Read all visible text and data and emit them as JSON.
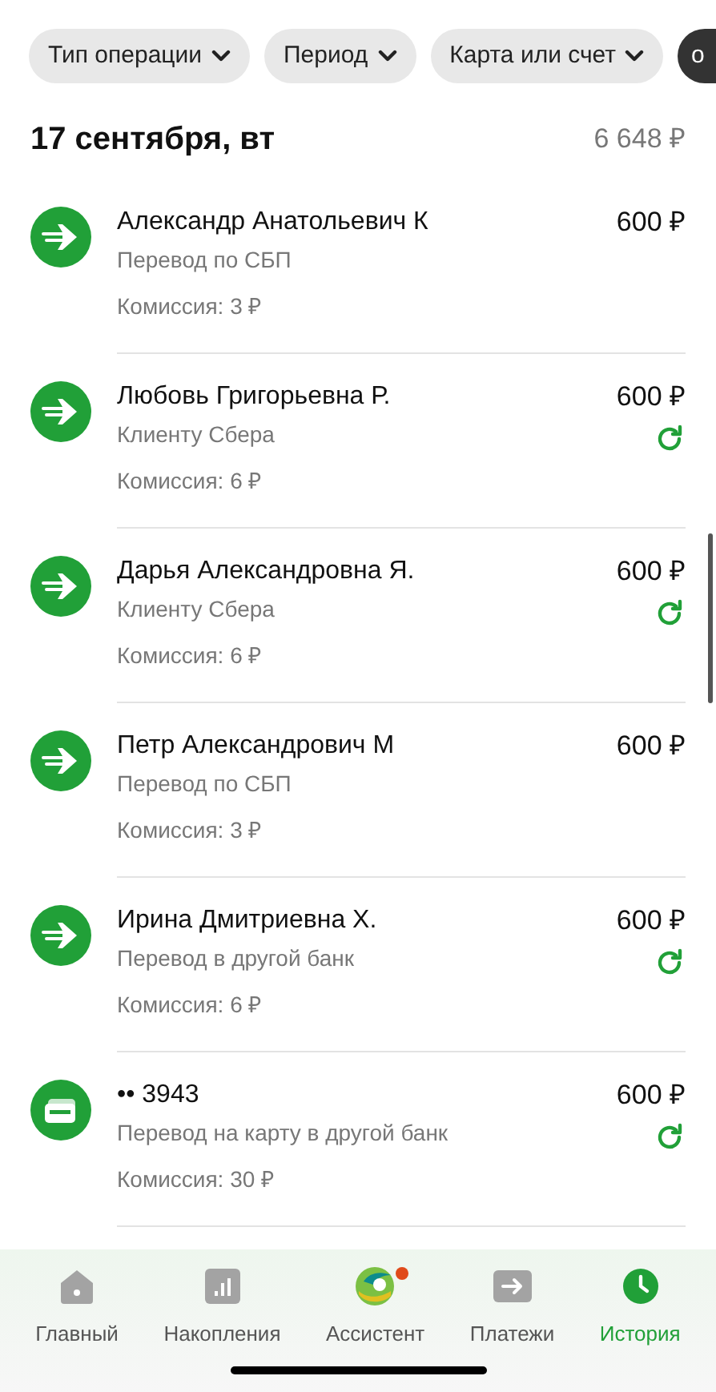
{
  "filters": [
    {
      "label": "Тип операции",
      "kind": "dropdown"
    },
    {
      "label": "Период",
      "kind": "dropdown"
    },
    {
      "label": "Карта или счет",
      "kind": "dropdown"
    },
    {
      "label": "о",
      "kind": "dark"
    }
  ],
  "day": {
    "date": "17 сентября, вт",
    "total": "6 648 ₽"
  },
  "transactions": [
    {
      "kind": "transfer",
      "name": "Александр Анатольевич К",
      "type": "Перевод по СБП",
      "commission": "Комиссия: 3 ₽",
      "amount": "600 ₽",
      "repeat": false
    },
    {
      "kind": "transfer",
      "name": "Любовь Григорьевна Р.",
      "type": "Клиенту Сбера",
      "commission": "Комиссия: 6 ₽",
      "amount": "600 ₽",
      "repeat": true
    },
    {
      "kind": "transfer",
      "name": "Дарья Александровна Я.",
      "type": "Клиенту Сбера",
      "commission": "Комиссия: 6 ₽",
      "amount": "600 ₽",
      "repeat": true
    },
    {
      "kind": "transfer",
      "name": "Петр Александрович М",
      "type": "Перевод по СБП",
      "commission": "Комиссия: 3 ₽",
      "amount": "600 ₽",
      "repeat": false
    },
    {
      "kind": "transfer",
      "name": "Ирина Дмитриевна Х.",
      "type": "Перевод в другой банк",
      "commission": "Комиссия: 6 ₽",
      "amount": "600 ₽",
      "repeat": true
    },
    {
      "kind": "card",
      "name": "•• 3943",
      "type": "Перевод на карту в другой банк",
      "commission": "Комиссия: 30 ₽",
      "amount": "600 ₽",
      "repeat": true
    }
  ],
  "nav": [
    {
      "label": "Главный",
      "kind": "home",
      "selected": false,
      "badge": false
    },
    {
      "label": "Накопления",
      "kind": "chart",
      "selected": false,
      "badge": false
    },
    {
      "label": "Ассистент",
      "kind": "assistant",
      "selected": false,
      "badge": true
    },
    {
      "label": "Платежи",
      "kind": "payments",
      "selected": false,
      "badge": false
    },
    {
      "label": "История",
      "kind": "history",
      "selected": true,
      "badge": false
    }
  ]
}
